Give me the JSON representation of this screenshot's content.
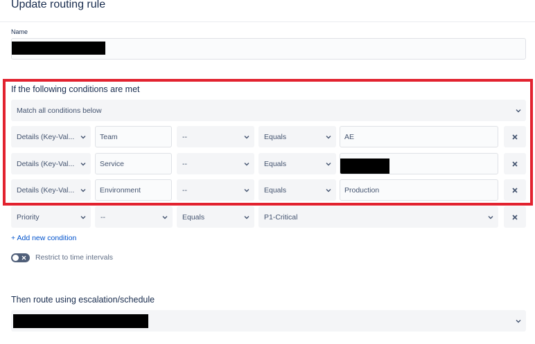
{
  "page": {
    "title": "Update routing rule"
  },
  "name_field": {
    "label": "Name"
  },
  "conditions": {
    "heading": "If the following conditions are met",
    "match_mode": "Match all conditions below",
    "rows": [
      {
        "field": "Details (Key-Val...",
        "key": "Team",
        "modifier": "--",
        "operator": "Equals",
        "value": "AE"
      },
      {
        "field": "Details (Key-Val...",
        "key": "Service",
        "modifier": "--",
        "operator": "Equals",
        "value": ""
      },
      {
        "field": "Details (Key-Val...",
        "key": "Environment",
        "modifier": "--",
        "operator": "Equals",
        "value": "Production"
      },
      {
        "field": "Priority",
        "modifier": "--",
        "operator": "Equals",
        "value": "P1-Critical"
      }
    ],
    "add_label": "+ Add new condition",
    "restrict_label": "Restrict to time intervals"
  },
  "route": {
    "heading": "Then route using escalation/schedule"
  },
  "colors": {
    "highlight": "#e2222f",
    "link": "#0052cc",
    "redaction": "#000000"
  }
}
